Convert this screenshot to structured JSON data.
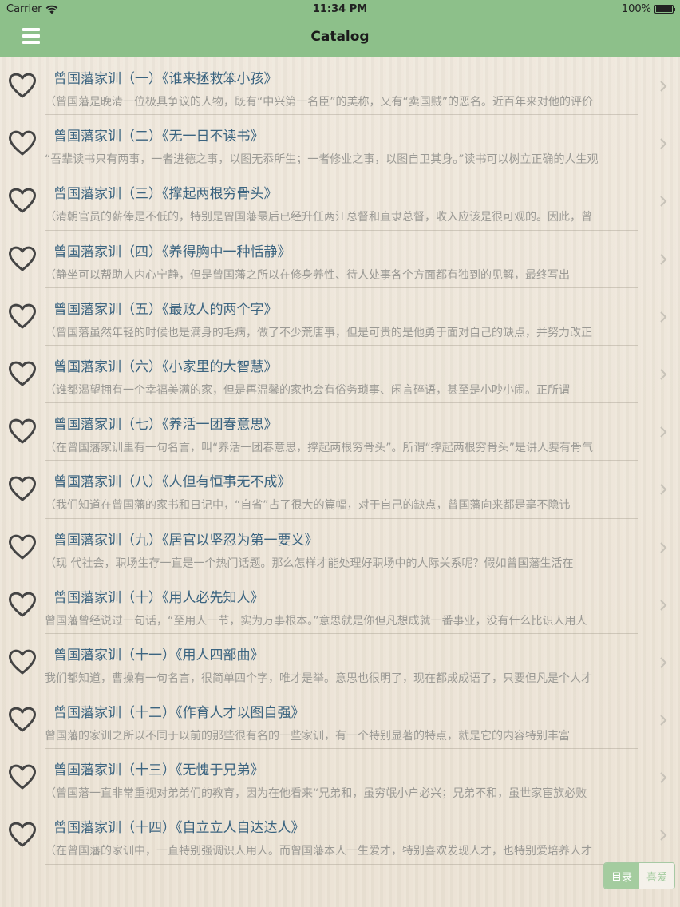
{
  "status_bar": {
    "carrier": "Carrier",
    "time": "11:34 PM",
    "battery": "100%"
  },
  "nav": {
    "title": "Catalog",
    "menu_icon": "hamburger-menu-icon"
  },
  "colors": {
    "nav_bg": "#8dc08a",
    "title_text": "#3b6480",
    "subtitle_text": "#9b9a95",
    "heart_stroke": "#444444"
  },
  "items": [
    {
      "title": "曾国藩家训（一）《谁来拯救笨小孩》",
      "subtitle": "（曾国藩是晚清一位极具争议的人物，既有“中兴第一名臣”的美称，又有“卖国贼”的恶名。近百年来对他的评价"
    },
    {
      "title": "曾国藩家训（二）《无一日不读书》",
      "subtitle": "“吾辈读书只有两事，一者进德之事，以图无忝所生；一者修业之事，以图自卫其身。”读书可以树立正确的人生观"
    },
    {
      "title": "曾国藩家训（三）《撑起两根穷骨头》",
      "subtitle": "（清朝官员的薪俸是不低的，特别是曾国藩最后已经升任两江总督和直隶总督，收入应该是很可观的。因此，曾"
    },
    {
      "title": "曾国藩家训（四）《养得胸中一种恬静》",
      "subtitle": "（静坐可以帮助人内心宁静，但是曾国藩之所以在修身养性、待人处事各个方面都有独到的见解，最终写出"
    },
    {
      "title": "曾国藩家训（五）《最败人的两个字》",
      "subtitle": "（曾国藩虽然年轻的时候也是满身的毛病，做了不少荒唐事，但是可贵的是他勇于面对自己的缺点，并努力改正"
    },
    {
      "title": "曾国藩家训（六）《小家里的大智慧》",
      "subtitle": "（谁都渴望拥有一个幸福美满的家，但是再温馨的家也会有俗务琐事、闲言碎语，甚至是小吵小闹。正所谓"
    },
    {
      "title": "曾国藩家训（七）《养活一团春意思》",
      "subtitle": "（在曾国藩家训里有一句名言，叫“养活一团春意思，撑起两根穷骨头”。所谓“撑起两根穷骨头”是讲人要有骨气"
    },
    {
      "title": "曾国藩家训（八）《人但有恒事无不成》",
      "subtitle": "（我们知道在曾国藩的家书和日记中，“自省”占了很大的篇幅，对于自己的缺点，曾国藩向来都是毫不隐讳"
    },
    {
      "title": "曾国藩家训（九）《居官以坚忍为第一要义》",
      "subtitle": "（现 代社会，职场生存一直是一个热门话题。那么怎样才能处理好职场中的人际关系呢？假如曾国藩生活在"
    },
    {
      "title": "曾国藩家训（十）《用人必先知人》",
      "subtitle": "曾国藩曾经说过一句话，“至用人一节，实为万事根本。”意思就是你但凡想成就一番事业，没有什么比识人用人"
    },
    {
      "title": "曾国藩家训（十一）《用人四部曲》",
      "subtitle": "我们都知道，曹操有一句名言，很简单四个字，唯才是举。意思也很明了，现在都成成语了，只要但凡是个人才"
    },
    {
      "title": "曾国藩家训（十二）《作育人才以图自强》",
      "subtitle": "曾国藩的家训之所以不同于以前的那些很有名的一些家训，有一个特别显著的特点，就是它的内容特别丰富"
    },
    {
      "title": "曾国藩家训（十三）《无愧于兄弟》",
      "subtitle": "（曾国藩一直非常重视对弟弟们的教育，因为在他看来“兄弟和，虽穷氓小户必兴；兄弟不和，虽世家宦族必败"
    },
    {
      "title": "曾国藩家训（十四）《自立立人自达达人》",
      "subtitle": "（在曾国藩的家训中，一直特别强调识人用人。而曾国藩本人一生爱才，特别喜欢发现人才，也特别爱培养人才"
    }
  ],
  "bottom_tabs": {
    "catalog_label": "目录",
    "favorites_label": "喜爱"
  }
}
